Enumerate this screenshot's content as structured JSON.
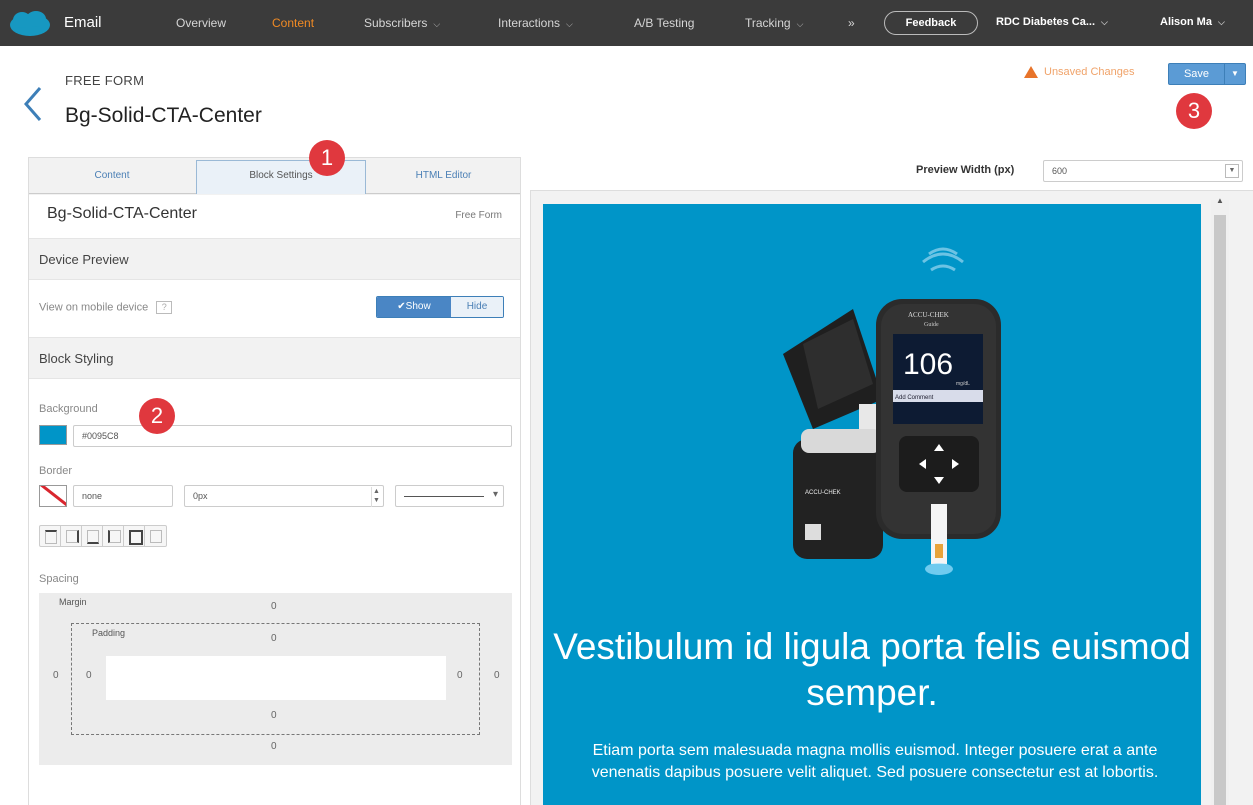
{
  "topnav": {
    "app_name": "Email",
    "items": [
      {
        "label": "Overview",
        "active": false,
        "has_dropdown": false
      },
      {
        "label": "Content",
        "active": true,
        "has_dropdown": false
      },
      {
        "label": "Subscribers",
        "active": false,
        "has_dropdown": true
      },
      {
        "label": "Interactions",
        "active": false,
        "has_dropdown": true
      },
      {
        "label": "A/B Testing",
        "active": false,
        "has_dropdown": false
      },
      {
        "label": "Tracking",
        "active": false,
        "has_dropdown": true
      }
    ],
    "more_symbol": "»",
    "feedback_label": "Feedback",
    "business_unit": "RDC Diabetes Ca...",
    "user_name": "Alison Ma",
    "accent_color": "#f08a24",
    "bar_color": "#3b3b3b"
  },
  "header": {
    "breadcrumb": "FREE FORM",
    "title": "Bg-Solid-CTA-Center",
    "unsaved_text": "Unsaved Changes",
    "save_label": "Save"
  },
  "annotations": [
    "1",
    "2",
    "3"
  ],
  "left_panel": {
    "tabs": [
      {
        "label": "Content",
        "active": false
      },
      {
        "label": "Block Settings",
        "active": true
      },
      {
        "label": "HTML Editor",
        "active": false
      }
    ],
    "block_name": "Bg-Solid-CTA-Center",
    "block_type": "Free Form",
    "device_preview": {
      "heading": "Device Preview",
      "label": "View on mobile device",
      "help": "?",
      "show_label": "✔Show",
      "hide_label": "Hide"
    },
    "block_styling": {
      "heading": "Block Styling",
      "background_label": "Background",
      "background_value": "#0095C8",
      "border_label": "Border",
      "border_color_value": "none",
      "border_width_value": "0px",
      "spacing_label": "Spacing",
      "margin_label": "Margin",
      "padding_label": "Padding",
      "margin": {
        "top": "0",
        "right": "0",
        "bottom": "0",
        "left": "0"
      },
      "padding": {
        "top": "0",
        "right": "0",
        "bottom": "0",
        "left": "0"
      }
    }
  },
  "preview": {
    "width_label": "Preview Width (px)",
    "width_value": "600",
    "background": "#0095c8",
    "meter_brand": "ACCU-CHEK",
    "meter_model": "Guide",
    "meter_reading": "106",
    "meter_unit": "mg/dL",
    "meter_menu": "Add Comment",
    "headline": "Vestibulum id ligula porta felis euismod semper.",
    "body": "Etiam porta sem malesuada magna mollis euismod. Integer posuere erat a ante venenatis dapibus posuere velit aliquet. Sed posuere consectetur est at lobortis."
  }
}
